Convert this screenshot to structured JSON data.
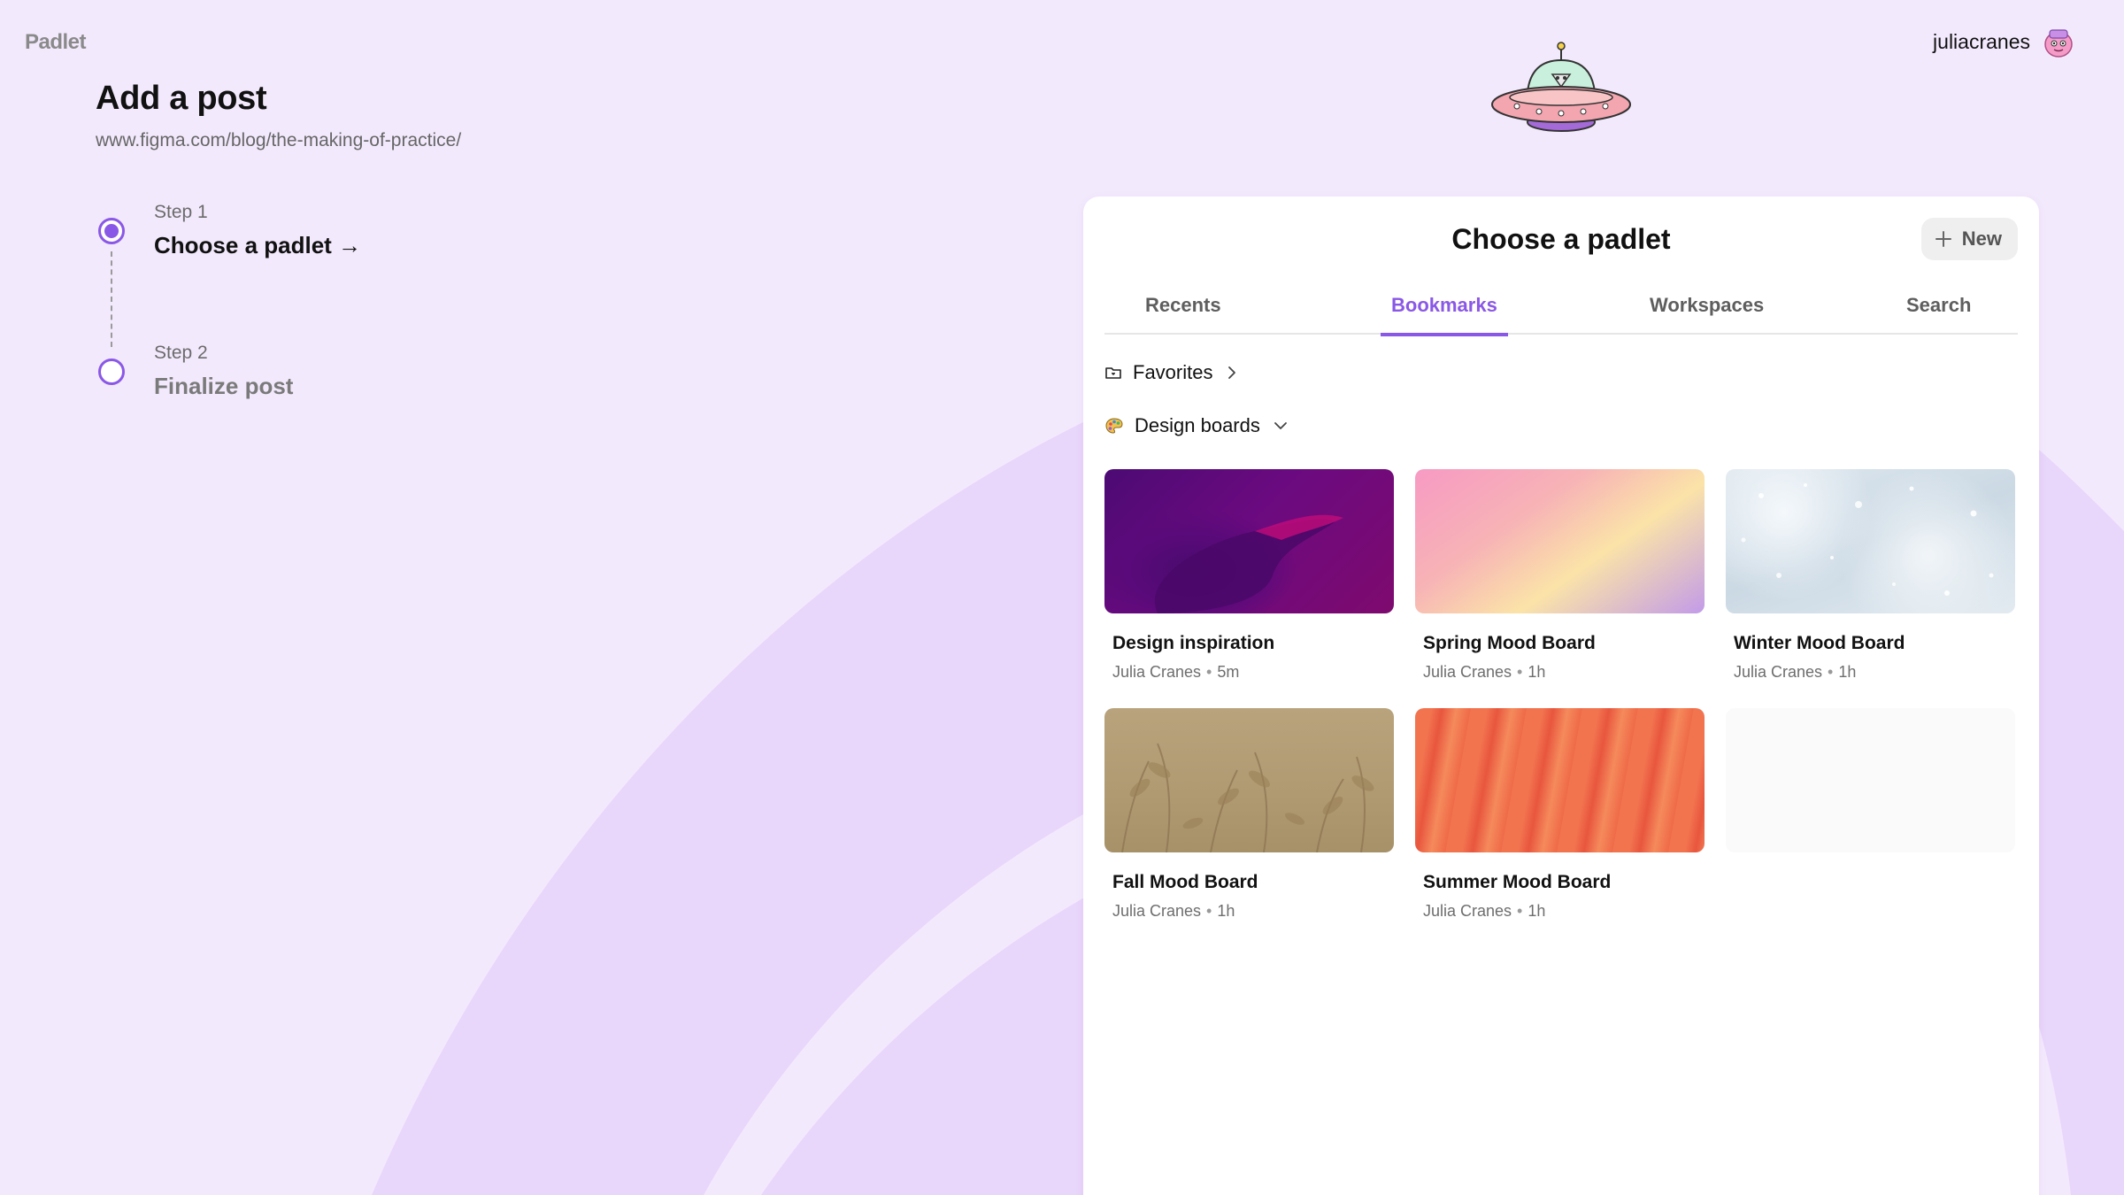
{
  "app": {
    "logo_text": "Padlet"
  },
  "user": {
    "username": "juliacranes"
  },
  "header": {
    "title": "Add a post",
    "url": "www.figma.com/blog/the-making-of-practice/"
  },
  "steps": [
    {
      "label": "Step 1",
      "name": "Choose a padlet →",
      "state": "active"
    },
    {
      "label": "Step 2",
      "name": "Finalize post",
      "state": "inactive"
    }
  ],
  "panel": {
    "title": "Choose a padlet",
    "new_button_label": "New",
    "tabs": [
      {
        "label": "Recents",
        "active": false
      },
      {
        "label": "Bookmarks",
        "active": true
      },
      {
        "label": "Workspaces",
        "active": false
      },
      {
        "label": "Search",
        "active": false
      }
    ],
    "breadcrumb": {
      "label": "Favorites",
      "icon": "folder-icon",
      "chevron": "chevron-right-icon"
    },
    "group": {
      "label": "Design boards",
      "icon": "palette-icon",
      "chevron": "chevron-down-icon"
    },
    "boards": [
      {
        "title": "Design inspiration",
        "author": "Julia Cranes",
        "time": "5m",
        "thumb": "purple-gradient"
      },
      {
        "title": "Spring Mood Board",
        "author": "Julia Cranes",
        "time": "1h",
        "thumb": "pastel-gradient"
      },
      {
        "title": "Winter Mood Board",
        "author": "Julia Cranes",
        "time": "1h",
        "thumb": "snow"
      },
      {
        "title": "Fall Mood Board",
        "author": "Julia Cranes",
        "time": "1h",
        "thumb": "botanical"
      },
      {
        "title": "Summer Mood Board",
        "author": "Julia Cranes",
        "time": "1h",
        "thumb": "orange-waves"
      }
    ]
  },
  "colors": {
    "accent": "#8a58e6",
    "background": "#f3e9fd",
    "arc": "#e9d6fb"
  }
}
